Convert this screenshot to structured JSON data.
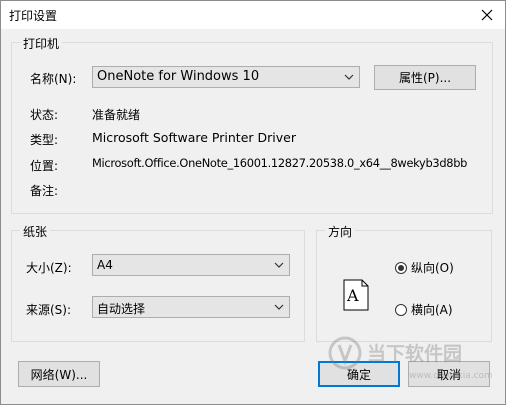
{
  "window": {
    "title": "打印设置"
  },
  "printer": {
    "legend": "打印机",
    "name_label": "名称(N):",
    "name_value": "OneNote for Windows 10",
    "properties_button": "属性(P)...",
    "status_label": "状态:",
    "status_value": "准备就绪",
    "type_label": "类型:",
    "type_value": "Microsoft Software Printer Driver",
    "location_label": "位置:",
    "location_value": "Microsoft.Office.OneNote_16001.12827.20538.0_x64__8wekyb3d8bb",
    "comment_label": "备注:"
  },
  "paper": {
    "legend": "纸张",
    "size_label": "大小(Z):",
    "size_value": "A4",
    "source_label": "来源(S):",
    "source_value": "自动选择"
  },
  "orientation": {
    "legend": "方向",
    "icon_letter": "A",
    "portrait_label": "纵向(O)",
    "landscape_label": "横向(A)",
    "selected": "portrait"
  },
  "buttons": {
    "network": "网络(W)...",
    "ok": "确定",
    "cancel": "取消"
  },
  "watermark": {
    "text": "当下软件园",
    "subtext": "www.downxia.com"
  }
}
